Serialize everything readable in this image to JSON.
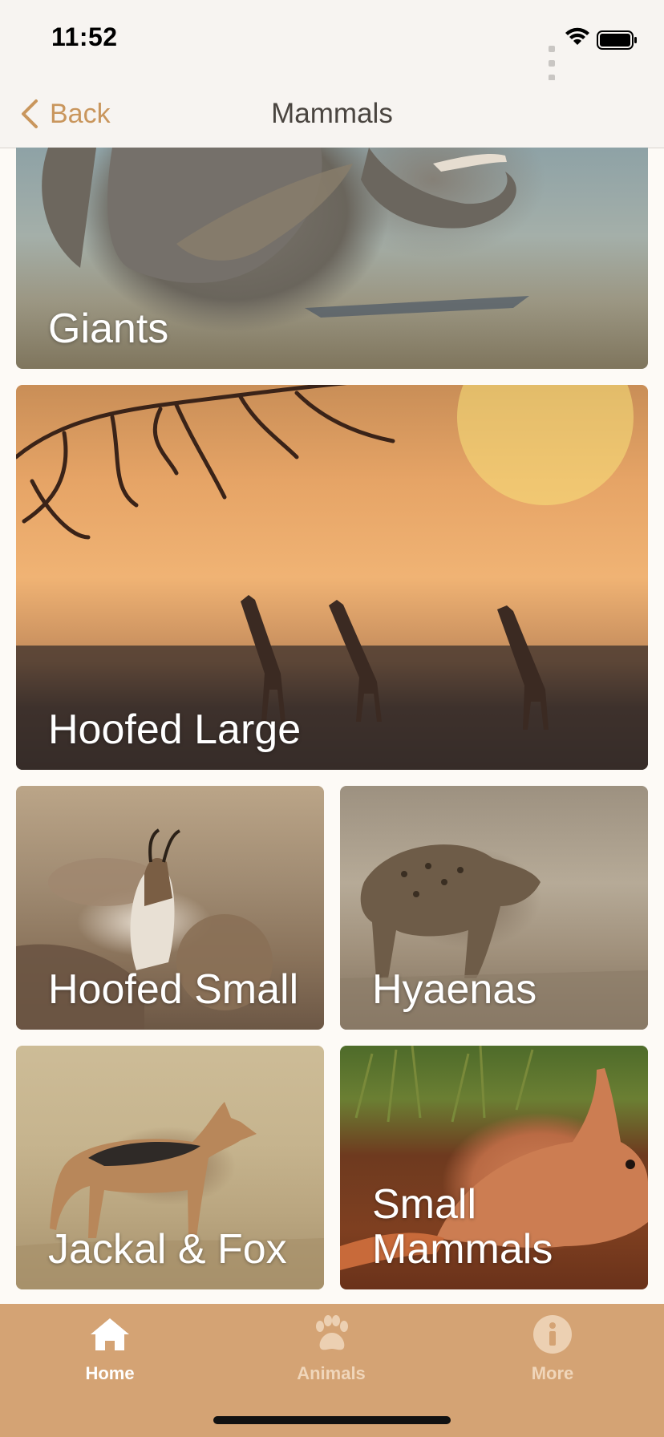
{
  "status_bar": {
    "time": "11:52"
  },
  "nav": {
    "back_label": "Back",
    "title": "Mammals"
  },
  "cards": [
    {
      "label": "Giants"
    },
    {
      "label": "Hoofed Large"
    },
    {
      "label": "Hoofed Small"
    },
    {
      "label": "Hyaenas"
    },
    {
      "label": "Jackal & Fox"
    },
    {
      "label": "Small Mammals"
    }
  ],
  "tabs": [
    {
      "label": "Home",
      "icon": "home-icon",
      "active": true
    },
    {
      "label": "Animals",
      "icon": "paw-icon",
      "active": false
    },
    {
      "label": "More",
      "icon": "info-icon",
      "active": false
    }
  ],
  "colors": {
    "accent": "#c9965d",
    "tab_bar": "#d4a374",
    "background": "#fdfaf6"
  }
}
